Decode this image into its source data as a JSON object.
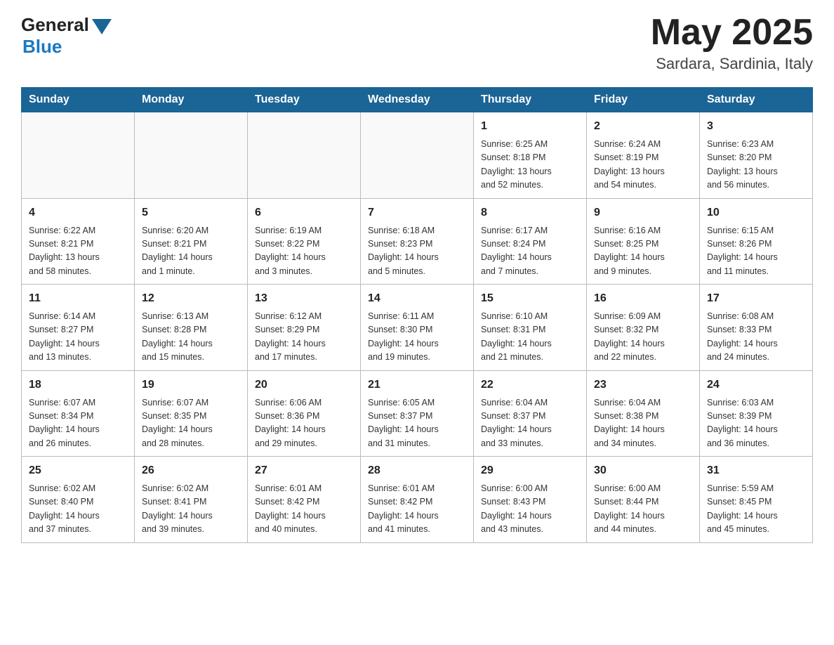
{
  "header": {
    "logo_general": "General",
    "logo_blue": "Blue",
    "month_title": "May 2025",
    "location": "Sardara, Sardinia, Italy"
  },
  "weekdays": [
    "Sunday",
    "Monday",
    "Tuesday",
    "Wednesday",
    "Thursday",
    "Friday",
    "Saturday"
  ],
  "weeks": [
    [
      {
        "day": "",
        "info": ""
      },
      {
        "day": "",
        "info": ""
      },
      {
        "day": "",
        "info": ""
      },
      {
        "day": "",
        "info": ""
      },
      {
        "day": "1",
        "info": "Sunrise: 6:25 AM\nSunset: 8:18 PM\nDaylight: 13 hours\nand 52 minutes."
      },
      {
        "day": "2",
        "info": "Sunrise: 6:24 AM\nSunset: 8:19 PM\nDaylight: 13 hours\nand 54 minutes."
      },
      {
        "day": "3",
        "info": "Sunrise: 6:23 AM\nSunset: 8:20 PM\nDaylight: 13 hours\nand 56 minutes."
      }
    ],
    [
      {
        "day": "4",
        "info": "Sunrise: 6:22 AM\nSunset: 8:21 PM\nDaylight: 13 hours\nand 58 minutes."
      },
      {
        "day": "5",
        "info": "Sunrise: 6:20 AM\nSunset: 8:21 PM\nDaylight: 14 hours\nand 1 minute."
      },
      {
        "day": "6",
        "info": "Sunrise: 6:19 AM\nSunset: 8:22 PM\nDaylight: 14 hours\nand 3 minutes."
      },
      {
        "day": "7",
        "info": "Sunrise: 6:18 AM\nSunset: 8:23 PM\nDaylight: 14 hours\nand 5 minutes."
      },
      {
        "day": "8",
        "info": "Sunrise: 6:17 AM\nSunset: 8:24 PM\nDaylight: 14 hours\nand 7 minutes."
      },
      {
        "day": "9",
        "info": "Sunrise: 6:16 AM\nSunset: 8:25 PM\nDaylight: 14 hours\nand 9 minutes."
      },
      {
        "day": "10",
        "info": "Sunrise: 6:15 AM\nSunset: 8:26 PM\nDaylight: 14 hours\nand 11 minutes."
      }
    ],
    [
      {
        "day": "11",
        "info": "Sunrise: 6:14 AM\nSunset: 8:27 PM\nDaylight: 14 hours\nand 13 minutes."
      },
      {
        "day": "12",
        "info": "Sunrise: 6:13 AM\nSunset: 8:28 PM\nDaylight: 14 hours\nand 15 minutes."
      },
      {
        "day": "13",
        "info": "Sunrise: 6:12 AM\nSunset: 8:29 PM\nDaylight: 14 hours\nand 17 minutes."
      },
      {
        "day": "14",
        "info": "Sunrise: 6:11 AM\nSunset: 8:30 PM\nDaylight: 14 hours\nand 19 minutes."
      },
      {
        "day": "15",
        "info": "Sunrise: 6:10 AM\nSunset: 8:31 PM\nDaylight: 14 hours\nand 21 minutes."
      },
      {
        "day": "16",
        "info": "Sunrise: 6:09 AM\nSunset: 8:32 PM\nDaylight: 14 hours\nand 22 minutes."
      },
      {
        "day": "17",
        "info": "Sunrise: 6:08 AM\nSunset: 8:33 PM\nDaylight: 14 hours\nand 24 minutes."
      }
    ],
    [
      {
        "day": "18",
        "info": "Sunrise: 6:07 AM\nSunset: 8:34 PM\nDaylight: 14 hours\nand 26 minutes."
      },
      {
        "day": "19",
        "info": "Sunrise: 6:07 AM\nSunset: 8:35 PM\nDaylight: 14 hours\nand 28 minutes."
      },
      {
        "day": "20",
        "info": "Sunrise: 6:06 AM\nSunset: 8:36 PM\nDaylight: 14 hours\nand 29 minutes."
      },
      {
        "day": "21",
        "info": "Sunrise: 6:05 AM\nSunset: 8:37 PM\nDaylight: 14 hours\nand 31 minutes."
      },
      {
        "day": "22",
        "info": "Sunrise: 6:04 AM\nSunset: 8:37 PM\nDaylight: 14 hours\nand 33 minutes."
      },
      {
        "day": "23",
        "info": "Sunrise: 6:04 AM\nSunset: 8:38 PM\nDaylight: 14 hours\nand 34 minutes."
      },
      {
        "day": "24",
        "info": "Sunrise: 6:03 AM\nSunset: 8:39 PM\nDaylight: 14 hours\nand 36 minutes."
      }
    ],
    [
      {
        "day": "25",
        "info": "Sunrise: 6:02 AM\nSunset: 8:40 PM\nDaylight: 14 hours\nand 37 minutes."
      },
      {
        "day": "26",
        "info": "Sunrise: 6:02 AM\nSunset: 8:41 PM\nDaylight: 14 hours\nand 39 minutes."
      },
      {
        "day": "27",
        "info": "Sunrise: 6:01 AM\nSunset: 8:42 PM\nDaylight: 14 hours\nand 40 minutes."
      },
      {
        "day": "28",
        "info": "Sunrise: 6:01 AM\nSunset: 8:42 PM\nDaylight: 14 hours\nand 41 minutes."
      },
      {
        "day": "29",
        "info": "Sunrise: 6:00 AM\nSunset: 8:43 PM\nDaylight: 14 hours\nand 43 minutes."
      },
      {
        "day": "30",
        "info": "Sunrise: 6:00 AM\nSunset: 8:44 PM\nDaylight: 14 hours\nand 44 minutes."
      },
      {
        "day": "31",
        "info": "Sunrise: 5:59 AM\nSunset: 8:45 PM\nDaylight: 14 hours\nand 45 minutes."
      }
    ]
  ]
}
